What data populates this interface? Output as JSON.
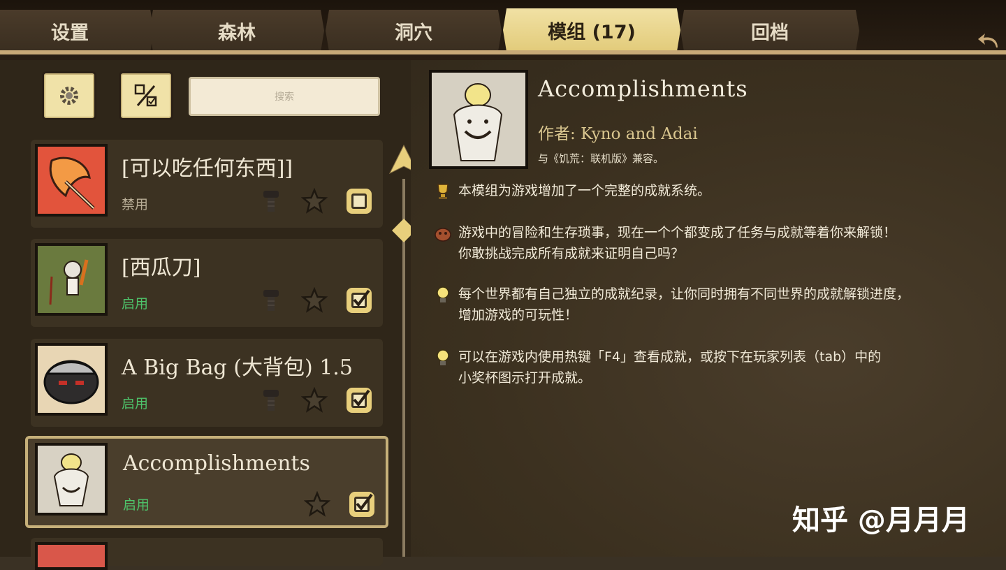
{
  "tabs": [
    {
      "label": "设置",
      "active": false
    },
    {
      "label": "森林",
      "active": false
    },
    {
      "label": "洞穴",
      "active": false
    },
    {
      "label": "模组 (17)",
      "active": true
    },
    {
      "label": "回档",
      "active": false
    }
  ],
  "toolbar": {
    "settings_icon": "gear-icon",
    "toggle_icon": "toggle-all-icon",
    "search_placeholder": "搜索"
  },
  "mods": [
    {
      "title": "[可以吃任何东西]]",
      "status": "禁用",
      "enabled": false,
      "has_config": true,
      "checked": false,
      "thumb": "orange-leaf"
    },
    {
      "title": "[西瓜刀]",
      "status": "启用",
      "enabled": true,
      "has_config": true,
      "checked": true,
      "thumb": "character-sword"
    },
    {
      "title": "A Big Bag (大背包) 1.5",
      "status": "启用",
      "enabled": true,
      "has_config": true,
      "checked": true,
      "thumb": "bag"
    },
    {
      "title": "Accomplishments",
      "status": "启用",
      "enabled": true,
      "has_config": false,
      "checked": true,
      "thumb": "trophy-character",
      "selected": true
    }
  ],
  "detail": {
    "title": "Accomplishments",
    "author_label": "作者:",
    "author": "Kyno and Adai",
    "compat": "与《饥荒：联机版》兼容。",
    "bullets": [
      {
        "icon": "trophy-icon",
        "text": "本模组为游戏增加了一个完整的成就系统。"
      },
      {
        "icon": "backpack-icon",
        "text": "游戏中的冒险和生存琐事，现在一个个都变成了任务与成就等着你来解锁！\n你敢挑战完成所有成就来证明自己吗？"
      },
      {
        "icon": "lightbulb-icon",
        "text": "每个世界都有自己独立的成就纪录，让你同时拥有不同世界的成就解锁进度，\n增加游戏的可玩性！"
      },
      {
        "icon": "lightbulb-icon",
        "text": "可以在游戏内使用热键「F4」查看成就，或按下在玩家列表（tab）中的\n小奖杯图示打开成就。"
      }
    ]
  },
  "watermark": "知乎 @月月月",
  "colors": {
    "accent": "#e8cf7c",
    "enabled": "#4ec46b",
    "disabled": "#b8ad96"
  }
}
